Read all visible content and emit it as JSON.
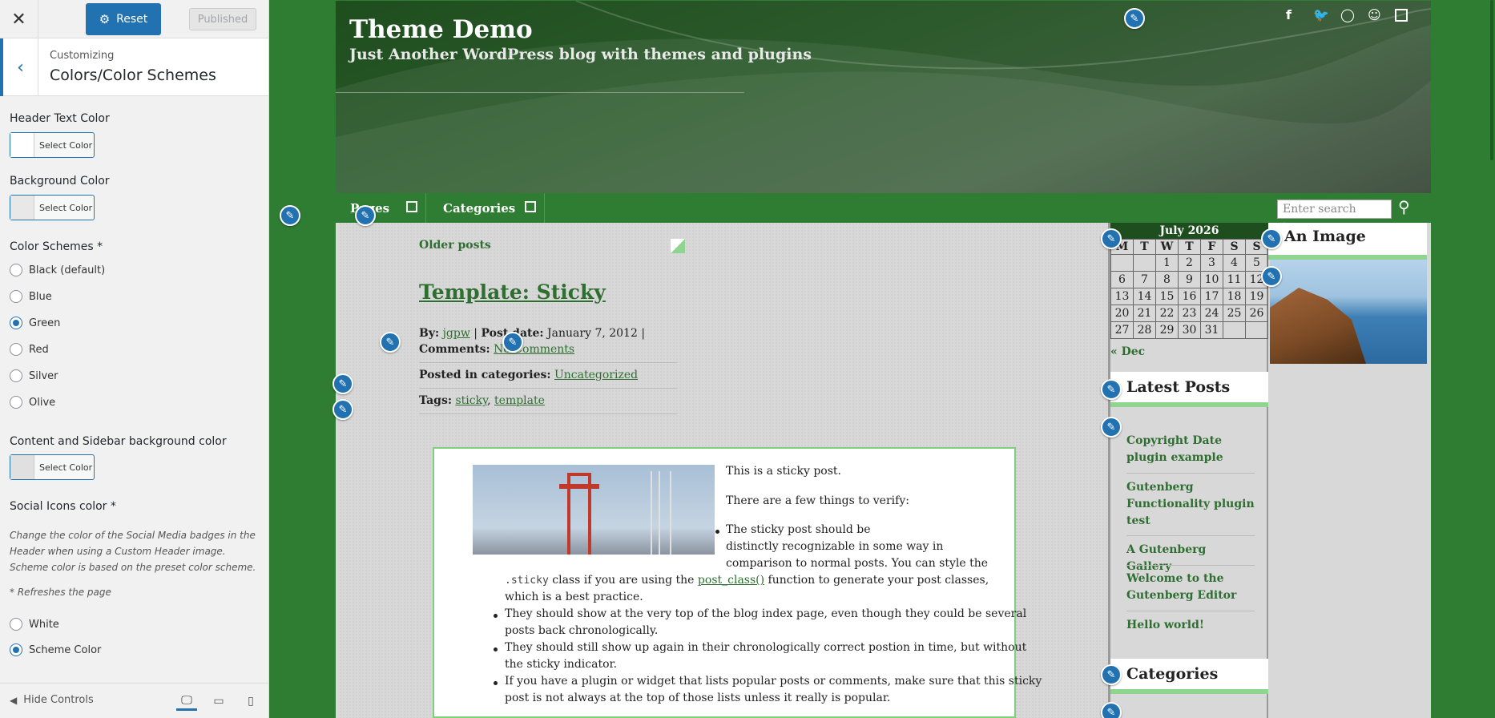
{
  "customizer": {
    "close_glyph": "✕",
    "reset_label": "Reset",
    "published_label": "Published",
    "customizing_label": "Customizing",
    "section_title": "Colors/Color Schemes",
    "header_text_color": {
      "label": "Header Text Color",
      "button": "Select Color",
      "swatch": "#ffffff"
    },
    "background_color": {
      "label": "Background Color",
      "button": "Select Color",
      "swatch": "#e8e8e8"
    },
    "color_schemes": {
      "label": "Color Schemes *",
      "options": [
        "Black (default)",
        "Blue",
        "Green",
        "Red",
        "Silver",
        "Olive"
      ],
      "selected": "Green"
    },
    "content_bg_color": {
      "label": "Content and Sidebar background color",
      "button": "Select Color",
      "swatch": "#e0e0e0"
    },
    "social_icons": {
      "label": "Social Icons color *",
      "description": "Change the color of the Social Media badges in the Header when using a Custom Header image. Scheme color is based on the preset color scheme.",
      "refresh_note": "* Refreshes the page",
      "options": [
        "White",
        "Scheme Color"
      ],
      "selected": "Scheme Color"
    },
    "footer": {
      "hide_controls": "Hide Controls"
    },
    "accent_color": "#2271b1"
  },
  "preview": {
    "site_title": "Theme Demo",
    "tagline": "Just Another WordPress blog with themes and plugins",
    "social_icons": [
      "facebook-icon",
      "twitter-icon",
      "github-icon"
    ],
    "nav": {
      "pages": "Pages",
      "categories": "Categories",
      "search_placeholder": "Enter search term..."
    },
    "older_posts": "Older posts",
    "post": {
      "title": "Template: Sticky",
      "by_label": "By:",
      "author": "jgpw",
      "date_label": "Post date:",
      "date": "January 7, 2012",
      "comments_label": "Comments:",
      "comments": "No Comments",
      "categories_label": "Posted in categories:",
      "category": "Uncategorized",
      "tags_label": "Tags:",
      "tags": [
        "sticky",
        "template"
      ],
      "p1": "This is a sticky post.",
      "p2": "There are a few things to verify:",
      "b1a": "The sticky post should be",
      "b1b": "distinctly recognizable in some way in",
      "b1c": "comparison to normal posts. You can style the",
      "b1_code": ".sticky",
      "b1_mid": "class if you are using the",
      "b1_link": "post_class()",
      "b1_end": "function to generate your post classes,",
      "b1_last": "which is a best practice.",
      "b2a": "They should show at the very top of the blog index page, even though they could be several",
      "b2b": "posts back chronologically.",
      "b3a": "They should still show up again in their chronologically correct postion in time, but without",
      "b3b": "the sticky indicator.",
      "b4a": "If you have a plugin or widget that lists popular posts or comments, make sure that this sticky",
      "b4b": "post is not always at the top of those lists unless it really is popular."
    },
    "calendar": {
      "title": "July 2026",
      "days": [
        "M",
        "T",
        "W",
        "T",
        "F",
        "S",
        "S"
      ],
      "weeks": [
        [
          "",
          "",
          "1",
          "2",
          "3",
          "4",
          "5"
        ],
        [
          "6",
          "7",
          "8",
          "9",
          "10",
          "11",
          "12"
        ],
        [
          "13",
          "14",
          "15",
          "16",
          "17",
          "18",
          "19"
        ],
        [
          "20",
          "21",
          "22",
          "23",
          "24",
          "25",
          "26"
        ],
        [
          "27",
          "28",
          "29",
          "30",
          "31",
          "",
          ""
        ]
      ],
      "prev": "« Dec"
    },
    "latest_posts": {
      "title": "Latest Posts",
      "items": [
        "Copyright Date plugin example",
        "Gutenberg Functionality plugin test",
        "A Gutenberg Gallery",
        "Welcome to the Gutenberg Editor",
        "Hello world!"
      ]
    },
    "categories_widget": {
      "title": "Categories"
    },
    "image_widget": {
      "title": "An Image"
    },
    "scheme_color": "#2e7d32"
  }
}
